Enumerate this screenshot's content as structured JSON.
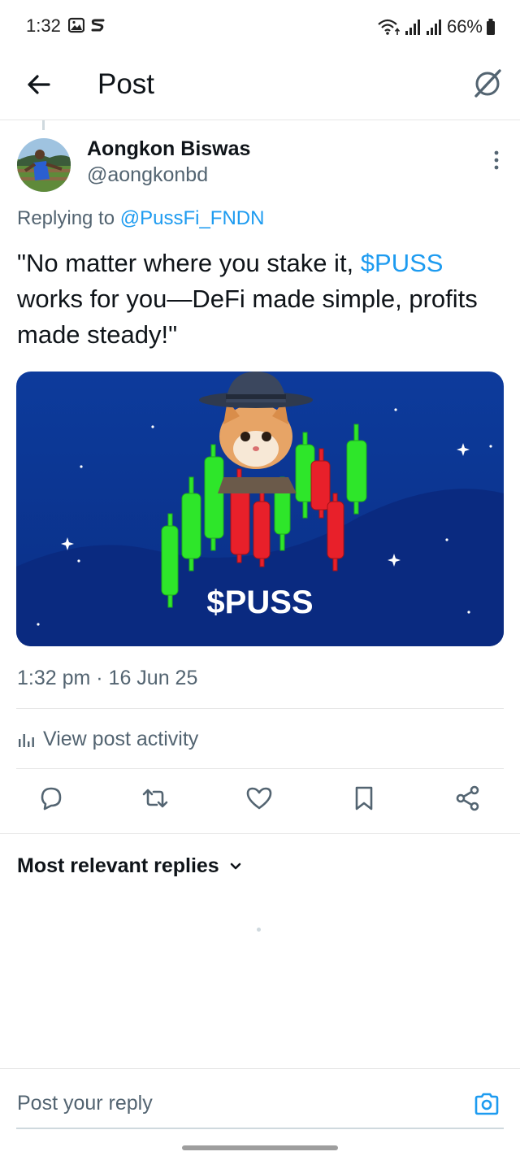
{
  "status_bar": {
    "time": "1:32",
    "battery": "66%",
    "icons": [
      "gallery-icon",
      "s-app-icon",
      "wifi-icon",
      "signal-icon",
      "signal-icon",
      "battery-icon"
    ]
  },
  "header": {
    "title": "Post",
    "back_icon": "arrow-left-icon",
    "grok_icon": "grok-icon"
  },
  "post": {
    "author_name": "Aongkon Biswas",
    "author_handle": "@aongkonbd",
    "replying_prefix": "Replying to ",
    "replying_to": "@PussFi_FNDN",
    "text_before": "\"No matter where you stake it, ",
    "cashtag": "$PUSS",
    "text_after": " works for you—DeFi made simple, profits made steady!\"",
    "image_caption": "$PUSS",
    "timestamp": "1:32 pm · 16 Jun 25",
    "view_activity": "View post activity"
  },
  "actions": [
    "reply-icon",
    "repost-icon",
    "like-icon",
    "bookmark-icon",
    "share-icon"
  ],
  "replies": {
    "sort_label": "Most relevant replies"
  },
  "reply_bar": {
    "placeholder": "Post your reply"
  },
  "colors": {
    "accent": "#1d9bf0",
    "muted": "#536471",
    "text": "#0f1419",
    "media_bg": "#0f3a9e",
    "candle_green": "#2ee62a",
    "candle_red": "#e8202a"
  }
}
